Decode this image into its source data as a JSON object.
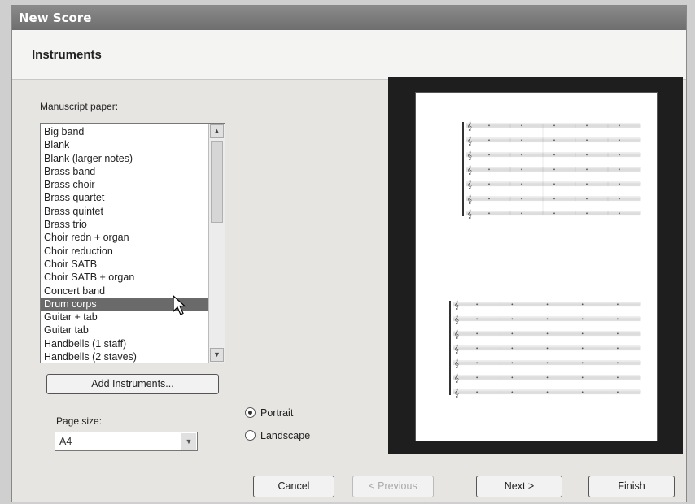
{
  "window": {
    "title": "New Score"
  },
  "section": {
    "heading": "Instruments"
  },
  "manuscript": {
    "label": "Manuscript paper:",
    "items": [
      "Big band",
      "Blank",
      "Blank (larger notes)",
      "Brass band",
      "Brass choir",
      "Brass quartet",
      "Brass quintet",
      "Brass trio",
      "Choir redn + organ",
      "Choir reduction",
      "Choir SATB",
      "Choir SATB + organ",
      "Concert band",
      "Drum corps",
      "Guitar + tab",
      "Guitar tab",
      "Handbells (1 staff)",
      "Handbells (2 staves)"
    ],
    "selected": "Drum corps"
  },
  "add_instruments_label": "Add Instruments...",
  "page_size": {
    "label": "Page size:",
    "value": "A4"
  },
  "orientation": {
    "portrait": "Portrait",
    "landscape": "Landscape",
    "selected": "Portrait"
  },
  "buttons": {
    "cancel": "Cancel",
    "previous": "< Previous",
    "next": "Next >",
    "finish": "Finish"
  },
  "preview": {
    "systems": 2,
    "staves_per_system": 7,
    "measures_per_staff": 5
  }
}
